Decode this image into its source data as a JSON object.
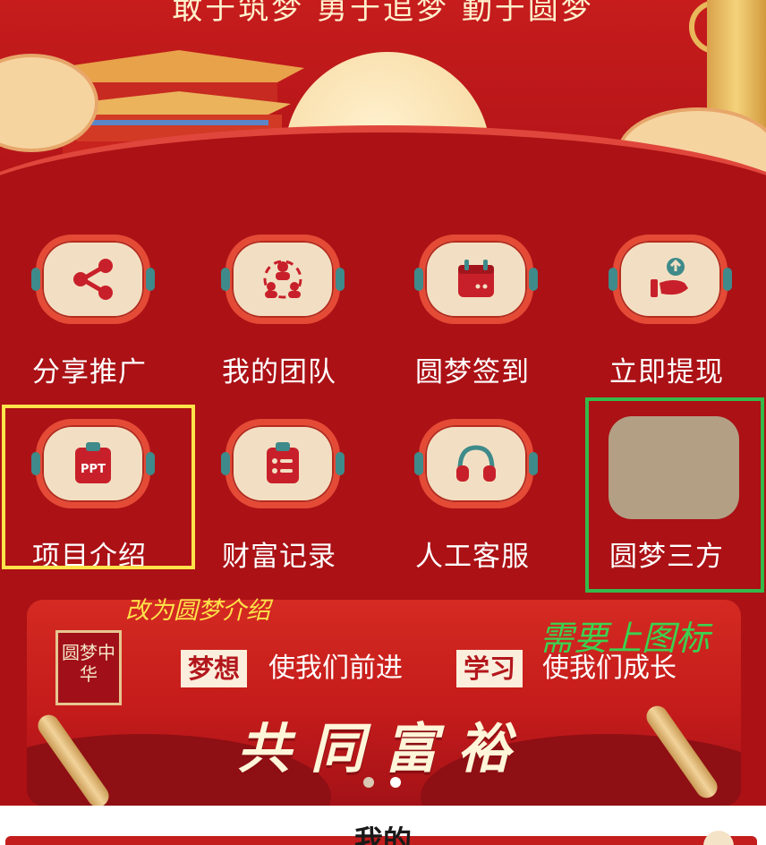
{
  "hero": {
    "slogan": "敢于筑梦 勇于追梦 勤于圆梦"
  },
  "menu": [
    {
      "label": "分享推广",
      "icon": "share-icon"
    },
    {
      "label": "我的团队",
      "icon": "team-icon"
    },
    {
      "label": "圆梦签到",
      "icon": "calendar-icon"
    },
    {
      "label": "立即提现",
      "icon": "withdraw-icon"
    },
    {
      "label": "项目介绍",
      "icon": "ppt-icon"
    },
    {
      "label": "财富记录",
      "icon": "clipboard-icon"
    },
    {
      "label": "人工客服",
      "icon": "headset-icon"
    },
    {
      "label": "圆梦三方",
      "icon": "placeholder-icon"
    }
  ],
  "annotations": {
    "yellow_note": "改为圆梦介绍",
    "green_note": "需要上图标",
    "yellow_color": "#ffe34a",
    "green_color": "#35b94a"
  },
  "banner": {
    "logo_text": "圆梦中华",
    "tag1": "梦想",
    "text1": "使我们前进",
    "tag2": "学习",
    "text2": "使我们成长",
    "big_text": "共同富裕",
    "carousel_count": 2,
    "carousel_active": 0
  },
  "bottom": {
    "title": "我的"
  },
  "colors": {
    "primary_red": "#ab1115",
    "icon_red": "#c8202a",
    "cream": "#f2dfc3"
  }
}
